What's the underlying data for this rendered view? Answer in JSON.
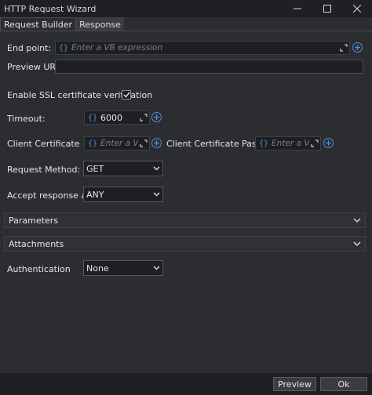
{
  "window": {
    "title": "HTTP Request Wizard"
  },
  "tabs": [
    {
      "label": "Request Builder",
      "active": true
    },
    {
      "label": "Response",
      "active": false
    }
  ],
  "endpoint": {
    "label": "End point:",
    "placeholder": "Enter a VB expression",
    "value": ""
  },
  "preview_url": {
    "label": "Preview URL:",
    "value": ""
  },
  "ssl": {
    "label": "Enable SSL certificate verification",
    "checked": true
  },
  "timeout": {
    "label": "Timeout:",
    "value": "6000"
  },
  "client_certificate": {
    "label": "Client Certificate",
    "placeholder": "Enter a VB"
  },
  "client_certificate_password": {
    "label": "Client Certificate Password",
    "placeholder": "Enter a VB"
  },
  "request_method": {
    "label": "Request Method:",
    "value": "GET"
  },
  "accept_response": {
    "label": "Accept response as:",
    "value": "ANY"
  },
  "sections": {
    "parameters": "Parameters",
    "attachments": "Attachments"
  },
  "authentication": {
    "label": "Authentication",
    "value": "None"
  },
  "footer": {
    "preview_label": "Preview",
    "ok_label": "Ok"
  },
  "icons": {
    "expression": "curly-braces-icon",
    "expand": "expand-arrows-icon",
    "add": "plus-circle-icon",
    "dropdown": "chevron-down-icon",
    "check": "checkmark-icon"
  },
  "colors": {
    "background": "#2b2d31",
    "titlebar": "#1f2023",
    "input": "#1e1f22",
    "accent": "#4f8fd8",
    "text": "#e6e6e6",
    "placeholder": "#7b7d84"
  }
}
